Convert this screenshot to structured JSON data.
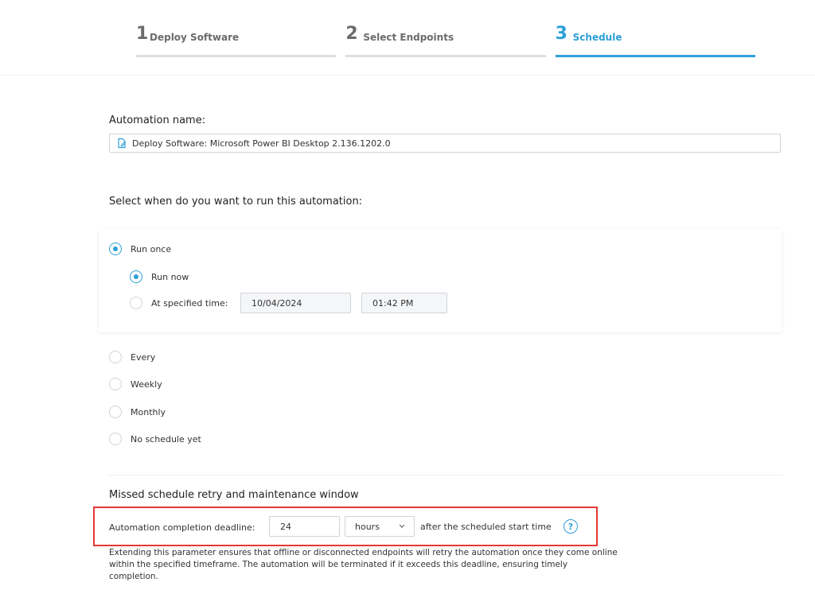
{
  "stepper": {
    "steps": [
      {
        "number": "1",
        "label": "Deploy Software"
      },
      {
        "number": "2",
        "label": "Select Endpoints"
      },
      {
        "number": "3",
        "label": "Schedule"
      }
    ],
    "active_index": 2
  },
  "automation": {
    "label": "Automation name:",
    "value": "Deploy Software: Microsoft Power BI Desktop 2.136.1202.0"
  },
  "schedule": {
    "heading": "Select when do you want to run this automation:",
    "options": {
      "run_once": "Run once",
      "run_now": "Run now",
      "at_specified_time": "At specified time:",
      "date": "10/04/2024",
      "time": "01:42 PM",
      "every": "Every",
      "weekly": "Weekly",
      "monthly": "Monthly",
      "no_schedule": "No schedule yet"
    }
  },
  "retry": {
    "heading": "Missed schedule retry and maintenance window",
    "deadline_label": "Automation completion deadline:",
    "deadline_value": "24",
    "unit_value": "hours",
    "after_text": "after the scheduled start time",
    "help_glyph": "?",
    "description": "Extending this parameter ensures that offline or disconnected endpoints will retry the automation once they come online within the specified timeframe. The automation will be terminated if it exceeds this deadline, ensuring timely completion."
  },
  "colors": {
    "accent": "#2da0d8",
    "highlight_frame": "#e53935"
  },
  "icons": {
    "name_field": "edit-document-icon",
    "unit_dropdown": "chevron-down-icon",
    "help": "help-icon"
  }
}
